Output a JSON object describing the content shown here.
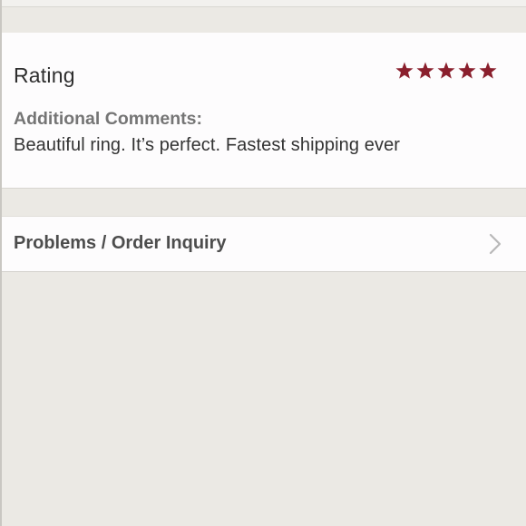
{
  "review": {
    "rating_label": "Rating",
    "rating_value": 5,
    "rating_max": 5,
    "star_color": "#8a1f2d",
    "comments_heading": "Additional Comments:",
    "comments_text": "Beautiful ring. It’s perfect. Fastest shipping ever"
  },
  "inquiry": {
    "label": "Problems / Order Inquiry",
    "icon": "chevron-right-icon"
  }
}
